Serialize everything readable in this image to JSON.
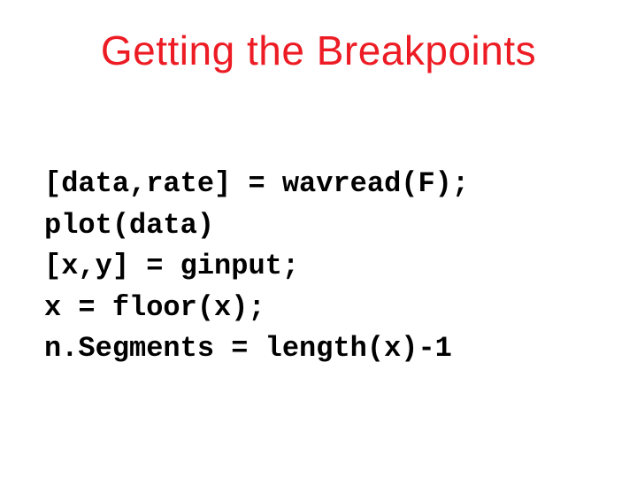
{
  "slide": {
    "title": "Getting the Breakpoints",
    "code": {
      "line1": "[data,rate] = wavread(F);",
      "line2": "plot(data)",
      "line3": "[x,y] = ginput;",
      "line4": "x = floor(x);",
      "line5": "n.Segments = length(x)-1"
    }
  }
}
